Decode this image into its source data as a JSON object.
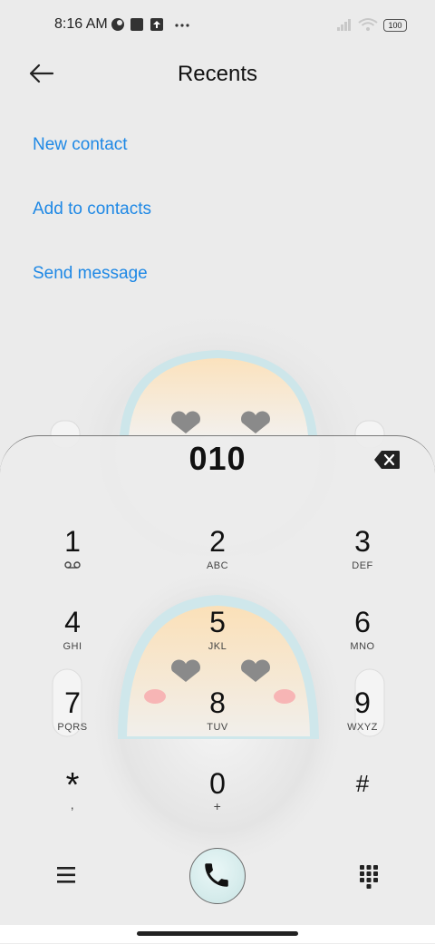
{
  "status_bar": {
    "time": "8:16 AM",
    "battery": "100"
  },
  "header": {
    "title": "Recents"
  },
  "actions": {
    "new_contact": "New contact",
    "add_to_contacts": "Add to contacts",
    "send_message": "Send message"
  },
  "dialer": {
    "number": "010",
    "keys": [
      {
        "digit": "1",
        "letters": ""
      },
      {
        "digit": "2",
        "letters": "ABC"
      },
      {
        "digit": "3",
        "letters": "DEF"
      },
      {
        "digit": "4",
        "letters": "GHI"
      },
      {
        "digit": "5",
        "letters": "JKL"
      },
      {
        "digit": "6",
        "letters": "MNO"
      },
      {
        "digit": "7",
        "letters": "PQRS"
      },
      {
        "digit": "8",
        "letters": "TUV"
      },
      {
        "digit": "9",
        "letters": "WXYZ"
      },
      {
        "digit": "*",
        "letters": ","
      },
      {
        "digit": "0",
        "letters": "+"
      },
      {
        "digit": "#",
        "letters": ""
      }
    ]
  },
  "icons": {
    "back": "arrow-left-icon",
    "backspace": "backspace-icon",
    "voicemail": "voicemail-icon",
    "menu": "menu-icon",
    "call": "phone-icon",
    "keypad": "dialpad-icon"
  },
  "colors": {
    "accent": "#1e88e5",
    "background": "#ebebeb"
  }
}
